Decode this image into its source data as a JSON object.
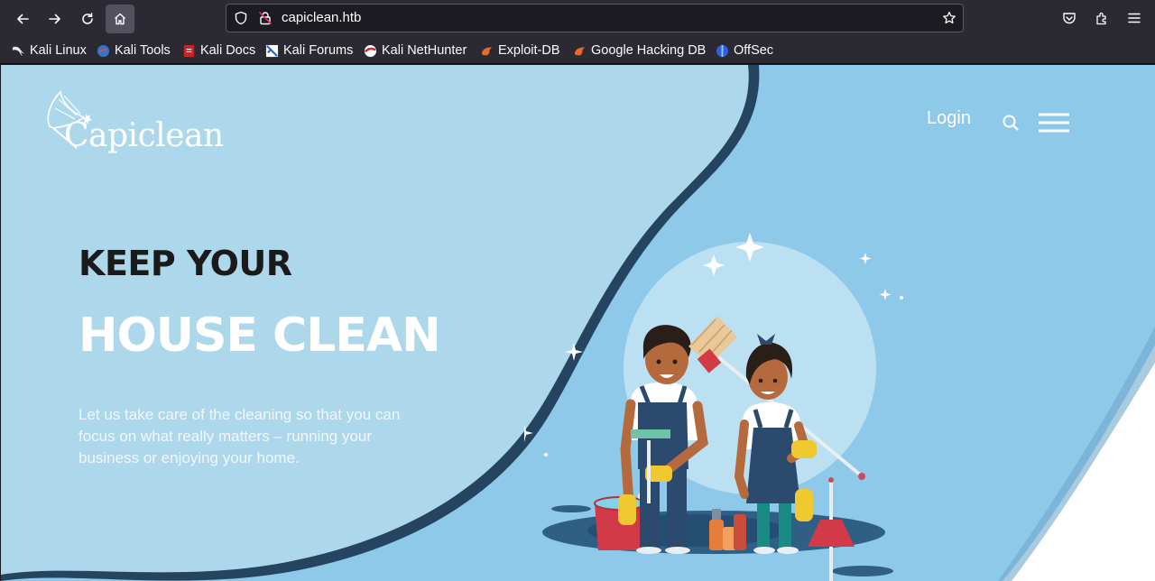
{
  "browser": {
    "url": "capiclean.htb",
    "bookmarks": [
      {
        "label": "Kali Linux",
        "icon": "kali-dragon-icon"
      },
      {
        "label": "Kali Tools",
        "icon": "kali-tools-icon"
      },
      {
        "label": "Kali Docs",
        "icon": "kali-docs-icon"
      },
      {
        "label": "Kali Forums",
        "icon": "kali-forums-icon"
      },
      {
        "label": "Kali NetHunter",
        "icon": "kali-nethunter-icon"
      },
      {
        "label": "Exploit-DB",
        "icon": "exploit-db-icon"
      },
      {
        "label": "Google Hacking DB",
        "icon": "ghdb-icon"
      },
      {
        "label": "OffSec",
        "icon": "offsec-icon"
      }
    ]
  },
  "site": {
    "logo_text": "Capiclean",
    "nav": {
      "login_label": "Login"
    },
    "hero": {
      "headline_top": "KEEP YOUR",
      "headline_main": "HOUSE CLEAN",
      "description": "Let us take care of the cleaning so that you can focus on what really matters – running your business or enjoying your home."
    }
  },
  "colors": {
    "chrome_bg": "#2b2a33",
    "page_light_blue": "#add8ec",
    "page_blue": "#8ec9ea",
    "wave_shadow": "#24445f",
    "text_dark": "#1a1a1a"
  }
}
